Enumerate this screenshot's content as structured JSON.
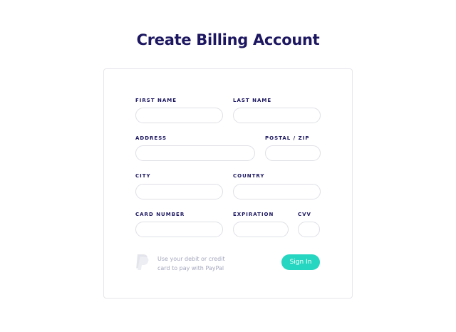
{
  "page": {
    "title": "Create Billing Account"
  },
  "form": {
    "first_name": {
      "label": "FIRST NAME",
      "value": "",
      "placeholder": ""
    },
    "last_name": {
      "label": "LAST NAME",
      "value": "",
      "placeholder": ""
    },
    "address": {
      "label": "ADDRESS",
      "value": "",
      "placeholder": ""
    },
    "postal": {
      "label": "POSTAL / ZIP",
      "value": "",
      "placeholder": ""
    },
    "city": {
      "label": "CITY",
      "value": "",
      "placeholder": ""
    },
    "country": {
      "label": "COUNTRY",
      "value": "",
      "placeholder": ""
    },
    "card_number": {
      "label": "CARD NUMBER",
      "value": "",
      "placeholder": ""
    },
    "expiration": {
      "label": "EXPIRATION",
      "value": "",
      "placeholder": ""
    },
    "cvv": {
      "label": "CVV",
      "value": "",
      "placeholder": ""
    }
  },
  "footer": {
    "paypal_icon": "paypal-icon",
    "paypal_line1": "Use your debit or credit",
    "paypal_line2": "card to pay with PayPal",
    "signin_label": "Sign In"
  },
  "colors": {
    "title": "#1c1760",
    "accent": "#27d6c0",
    "field_border": "#dfe0e6",
    "muted_text": "#a3a6bd",
    "paypal_icon": "#e4e5ec"
  }
}
